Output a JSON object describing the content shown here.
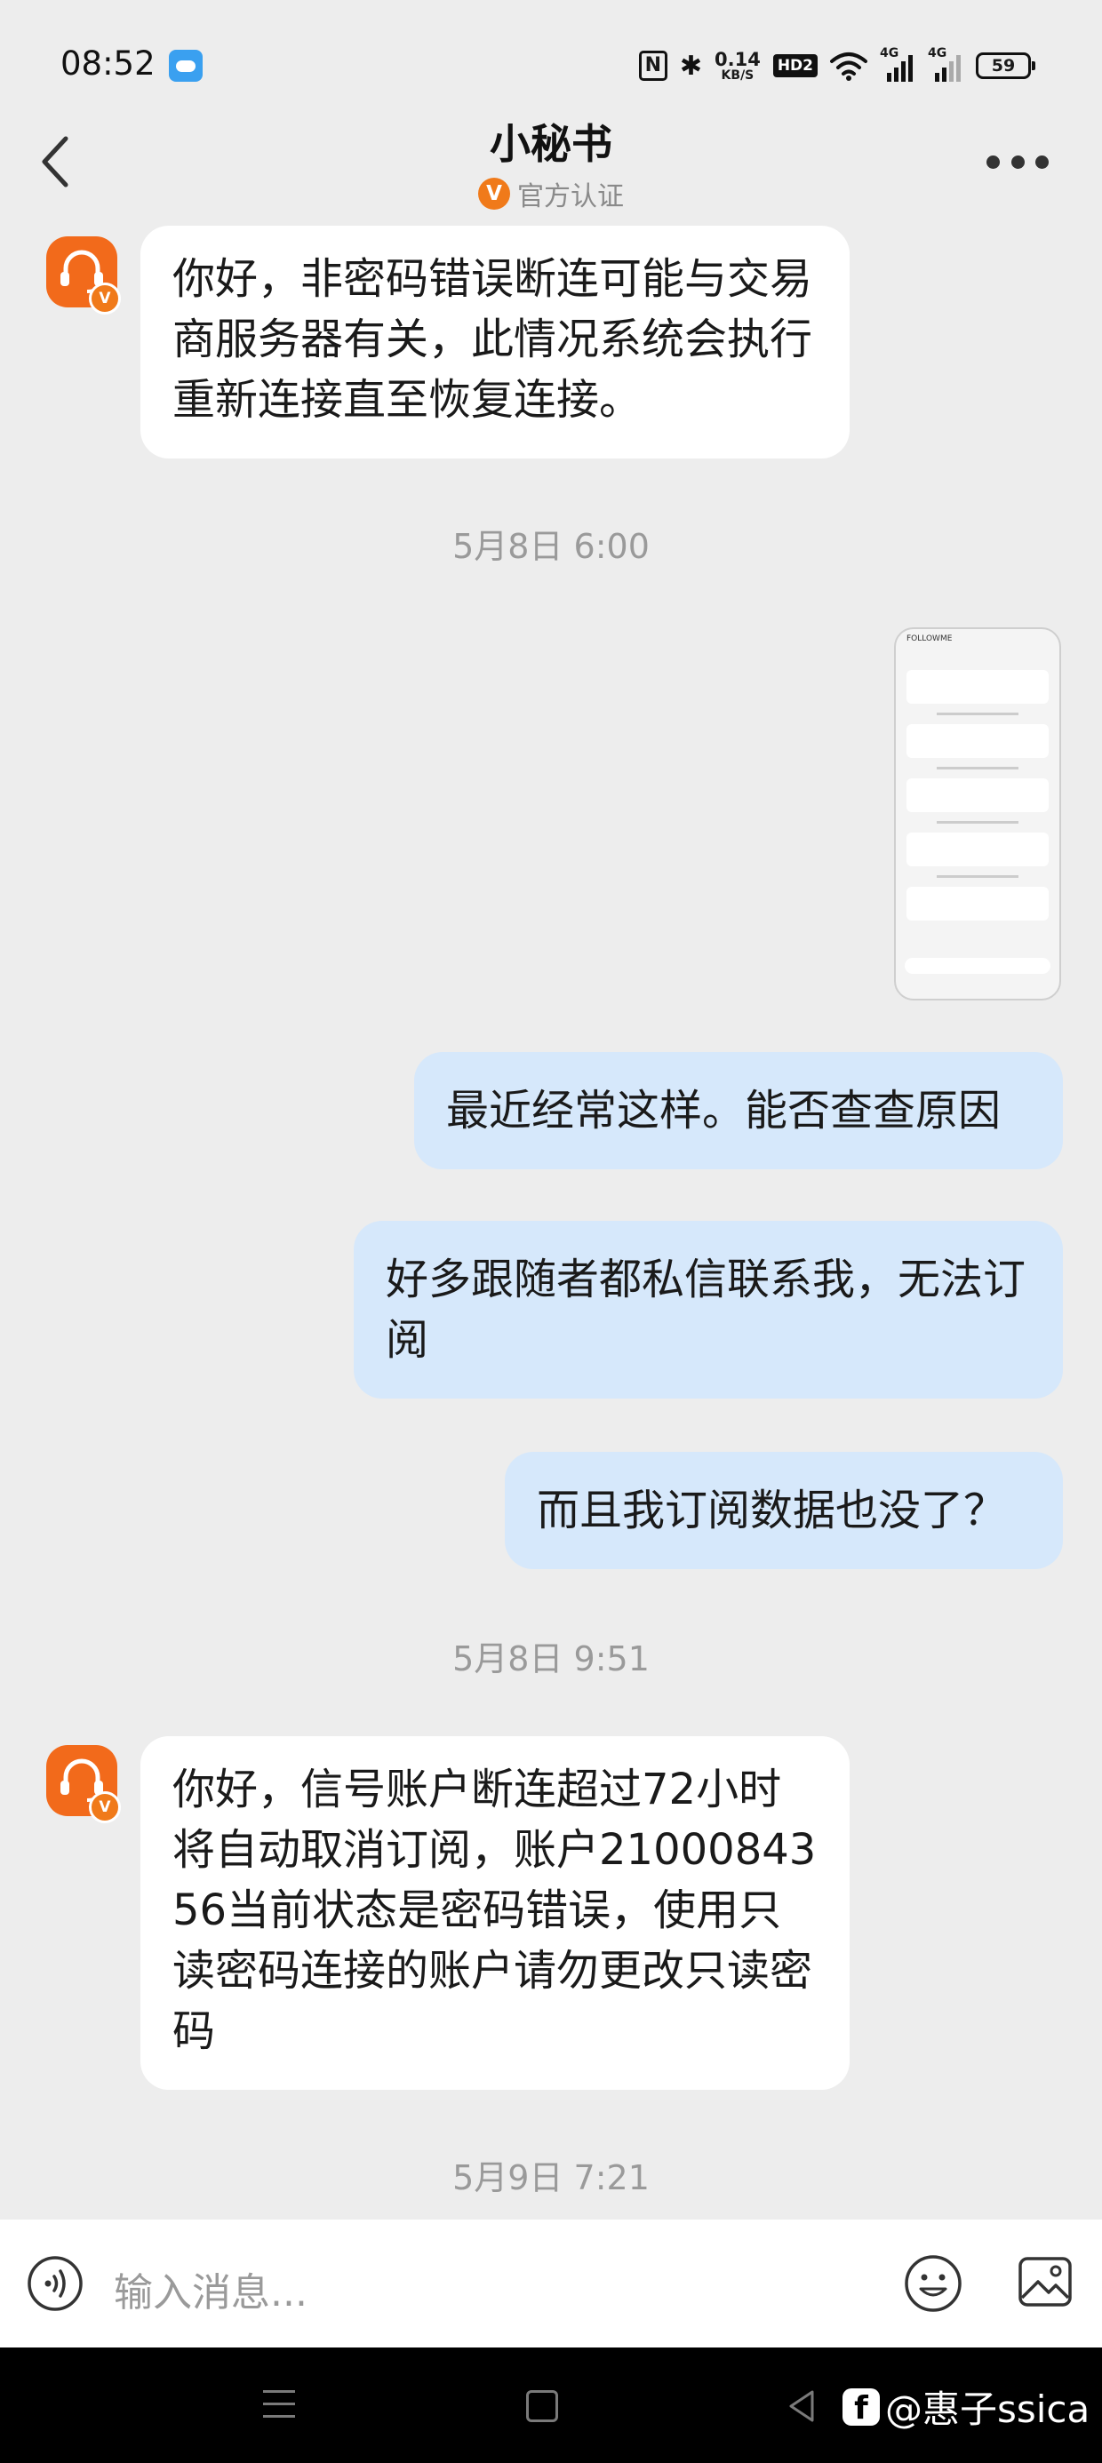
{
  "status_bar": {
    "time": "08:52",
    "net_speed_value": "0.14",
    "net_speed_unit": "KB/S",
    "hd_label": "HD2",
    "sim1_tag": "4G",
    "sim2_tag": "4G",
    "battery": "59"
  },
  "header": {
    "title": "小秘书",
    "verified_badge": "V",
    "verified_text": "官方认证"
  },
  "avatar_badge": "V",
  "messages": [
    {
      "side": "in",
      "text": "你好，非密码错误断连可能与交易商服务器有关，此情况系统会执行重新连接直至恢复连接。"
    },
    {
      "side": "time",
      "text": "5月8日 6:00"
    },
    {
      "side": "out",
      "type": "image",
      "text": "FOLLOWME"
    },
    {
      "side": "out",
      "text": "最近经常这样。能否查查原因"
    },
    {
      "side": "out",
      "text": "好多跟随者都私信联系我，无法订阅"
    },
    {
      "side": "out",
      "text": "而且我订阅数据也没了？"
    },
    {
      "side": "time",
      "text": "5月8日 9:51"
    },
    {
      "side": "in",
      "text": "你好，信号账户断连超过72小时将自动取消订阅，账户2100084356当前状态是密码错误，使用只读密码连接的账户请勿更改只读密码"
    },
    {
      "side": "time",
      "text": "5月9日 7:21"
    }
  ],
  "input": {
    "placeholder": "输入消息..."
  },
  "watermark": {
    "logo": "f",
    "text": "@惠子ssica"
  },
  "colors": {
    "accent": "#f07a1a",
    "outgoing_bubble": "#d6e8fb",
    "incoming_bubble": "#ffffff",
    "background": "#ededed"
  }
}
